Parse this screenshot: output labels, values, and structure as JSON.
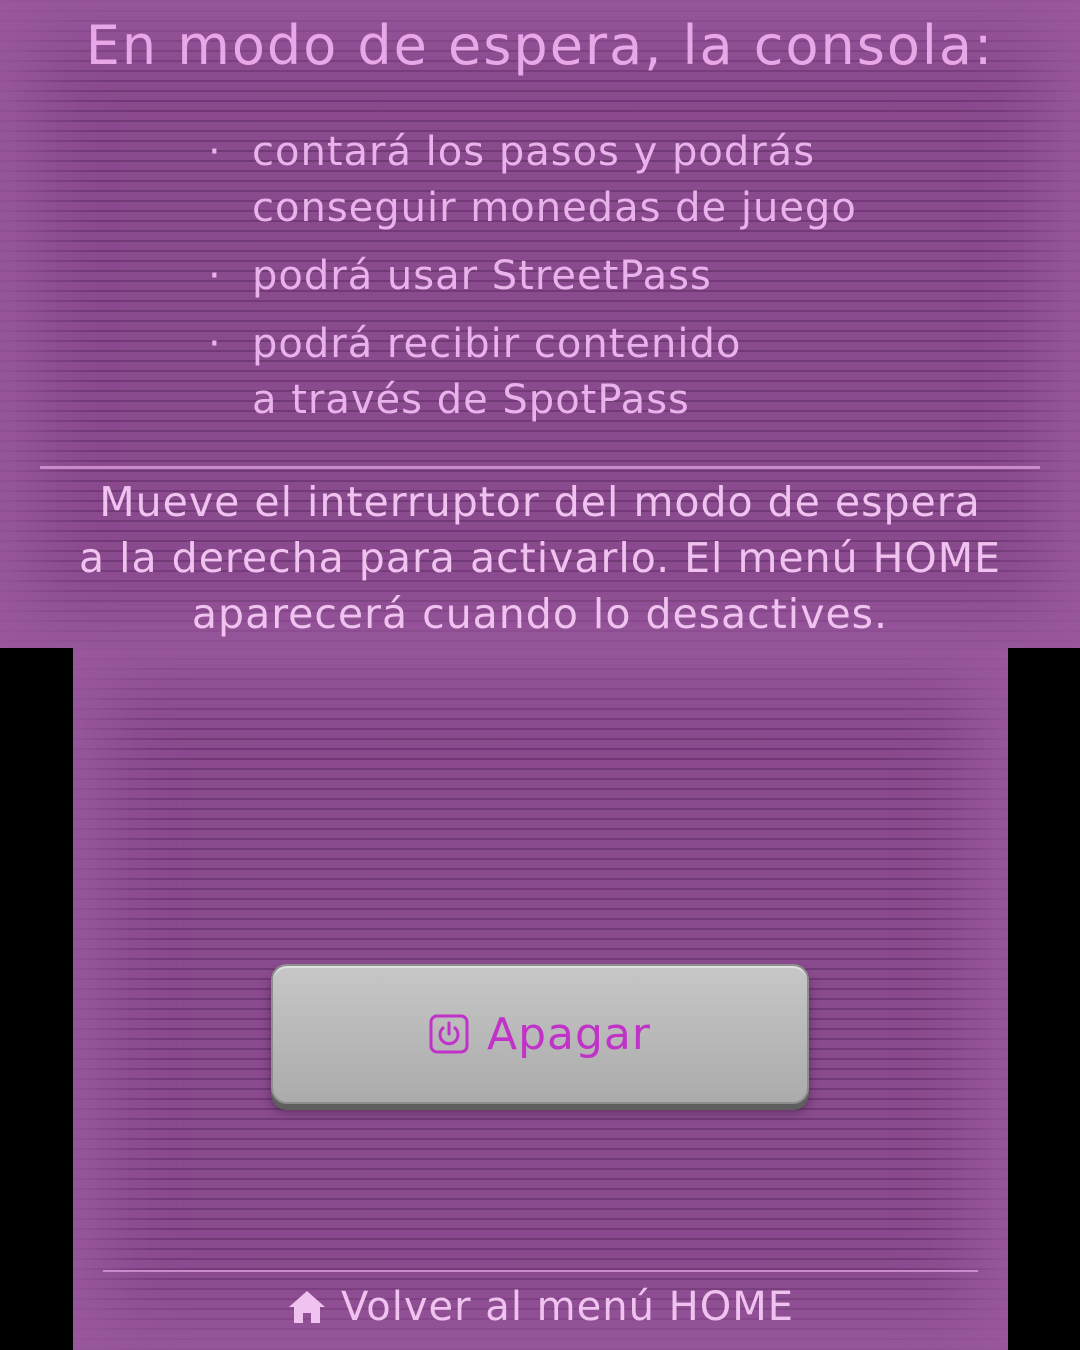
{
  "top_screen": {
    "title": "En modo de espera, la consola:",
    "bullet_symbol": "·",
    "bullets": [
      {
        "line1": "contará los pasos y podrás",
        "line2": "conseguir monedas de juego"
      },
      {
        "line1": "podrá usar StreetPass",
        "line2": ""
      },
      {
        "line1": "podrá recibir contenido",
        "line2": "a través de SpotPass"
      }
    ],
    "instruction": {
      "line1": "Mueve el interruptor del modo de espera",
      "line2": "a la derecha para activarlo. El menú HOME",
      "line3": "aparecerá cuando lo desactives."
    }
  },
  "bottom_screen": {
    "power_button": {
      "label": "Apagar",
      "icon": "power-icon"
    },
    "home_link": {
      "label": "Volver al menú HOME",
      "icon": "home-icon"
    }
  },
  "colors": {
    "background": "#8a4a8e",
    "text": "#e8b2ea",
    "button_text": "#c032c8",
    "button_face": "#bcbcbc",
    "letterbox": "#000000"
  }
}
